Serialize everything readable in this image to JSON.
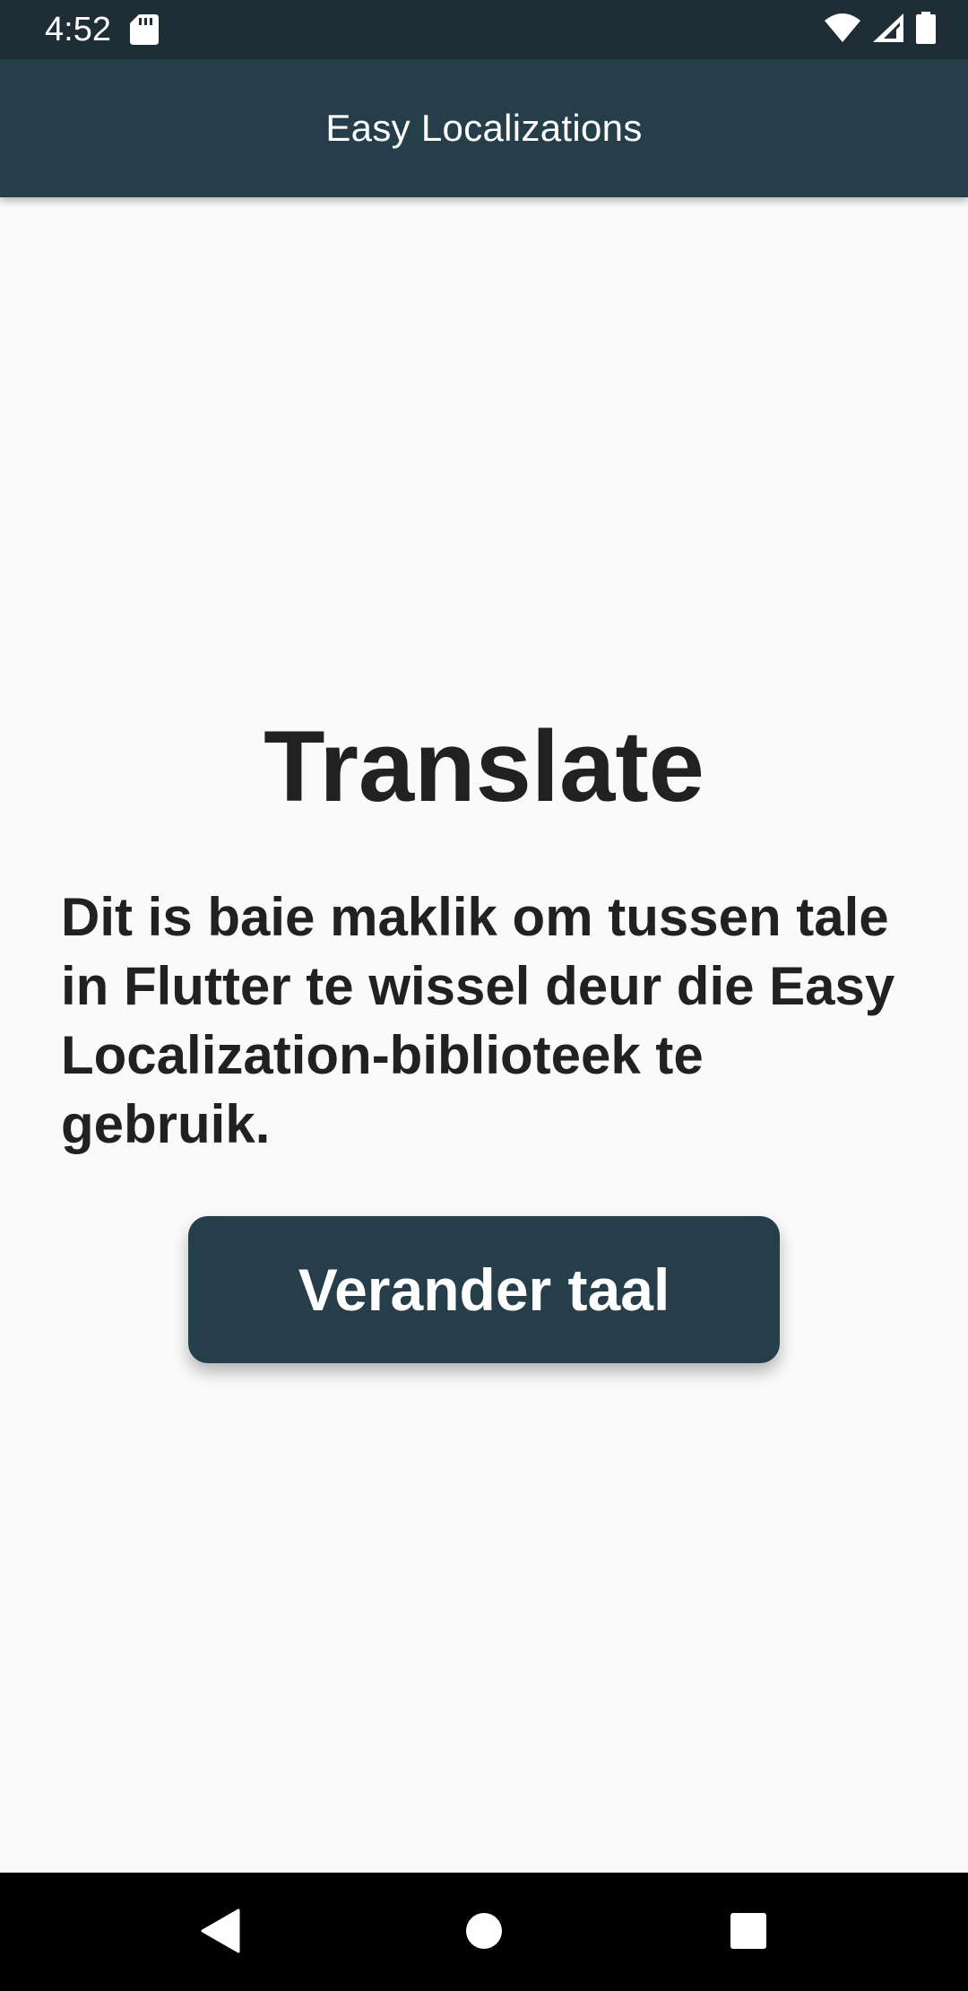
{
  "status_bar": {
    "time": "4:52",
    "icons": [
      "sd-card-icon",
      "wifi-icon",
      "cellular-signal-icon",
      "battery-icon"
    ]
  },
  "app_bar": {
    "title": "Easy Localizations"
  },
  "main": {
    "heading": "Translate",
    "description": "Dit is baie maklik om tussen tale in Flutter te wissel deur die Easy Localization-biblioteek te gebruik.",
    "button_label": "Verander taal"
  },
  "nav_bar": {
    "buttons": [
      "back-icon",
      "home-icon",
      "recents-icon"
    ]
  },
  "colors": {
    "status_bar": "#1f2d36",
    "primary": "#263d4a",
    "background": "#fafafa",
    "text": "#212121",
    "nav_bar": "#000000"
  }
}
